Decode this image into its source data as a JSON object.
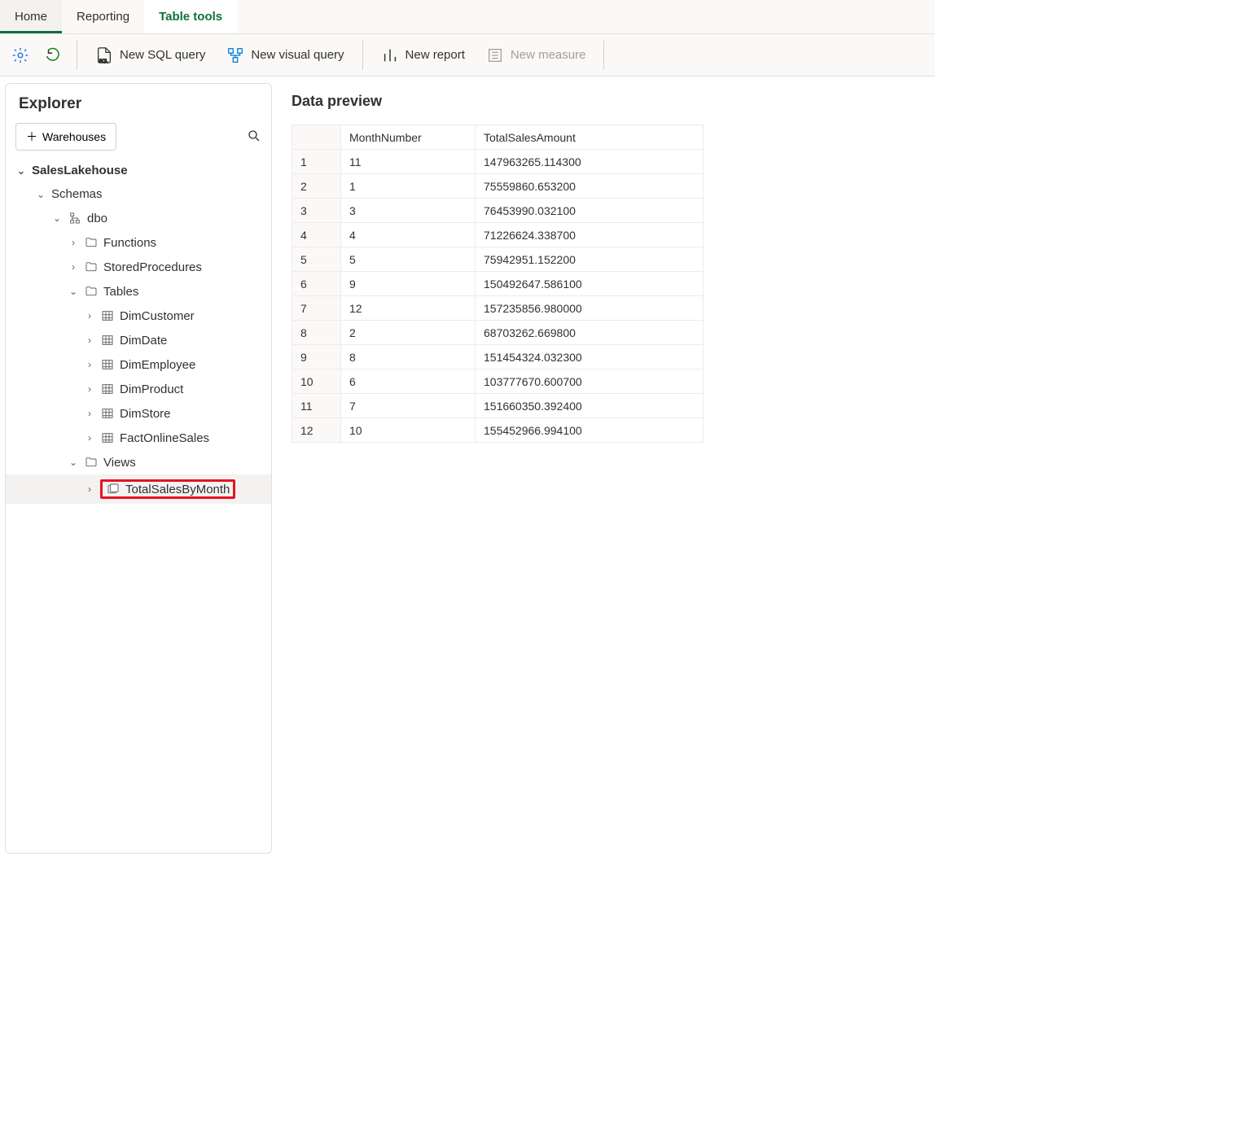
{
  "tabs": {
    "home": "Home",
    "reporting": "Reporting",
    "tools": "Table tools"
  },
  "toolbar": {
    "new_sql": "New SQL query",
    "new_visual": "New visual query",
    "new_report": "New report",
    "new_measure": "New measure"
  },
  "explorer": {
    "title": "Explorer",
    "warehouses_btn": "Warehouses",
    "tree": {
      "root": "SalesLakehouse",
      "schemas": "Schemas",
      "dbo": "dbo",
      "functions": "Functions",
      "stored": "StoredProcedures",
      "tables": "Tables",
      "table_items": [
        "DimCustomer",
        "DimDate",
        "DimEmployee",
        "DimProduct",
        "DimStore",
        "FactOnlineSales"
      ],
      "views": "Views",
      "view_item": "TotalSalesByMonth"
    }
  },
  "preview": {
    "title": "Data preview",
    "columns": [
      "MonthNumber",
      "TotalSalesAmount"
    ],
    "rows": [
      [
        "11",
        "147963265.114300"
      ],
      [
        "1",
        "75559860.653200"
      ],
      [
        "3",
        "76453990.032100"
      ],
      [
        "4",
        "71226624.338700"
      ],
      [
        "5",
        "75942951.152200"
      ],
      [
        "9",
        "150492647.586100"
      ],
      [
        "12",
        "157235856.980000"
      ],
      [
        "2",
        "68703262.669800"
      ],
      [
        "8",
        "151454324.032300"
      ],
      [
        "6",
        "103777670.600700"
      ],
      [
        "7",
        "151660350.392400"
      ],
      [
        "10",
        "155452966.994100"
      ]
    ]
  }
}
